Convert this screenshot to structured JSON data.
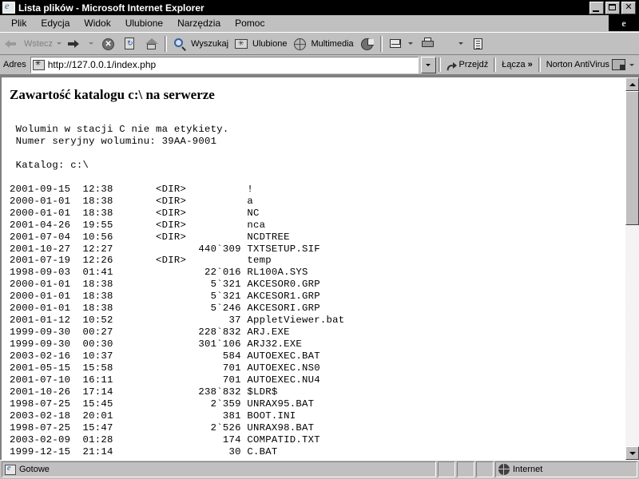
{
  "window": {
    "title": "Lista plików - Microsoft Internet Explorer",
    "app_icon": "ie-document-icon",
    "controls": {
      "minimize": "_",
      "maximize": "□",
      "close": "✕"
    }
  },
  "menubar": {
    "items": [
      {
        "label": "Plik",
        "name": "menu-file"
      },
      {
        "label": "Edycja",
        "name": "menu-edit"
      },
      {
        "label": "Widok",
        "name": "menu-view"
      },
      {
        "label": "Ulubione",
        "name": "menu-favorites"
      },
      {
        "label": "Narzędzia",
        "name": "menu-tools"
      },
      {
        "label": "Pomoc",
        "name": "menu-help"
      }
    ],
    "brand_glyph": "e"
  },
  "toolbar": {
    "back_label": "Wstecz",
    "forward_label": "",
    "search_label": "Wyszukaj",
    "favorites_label": "Ulubione",
    "multimedia_label": "Multimedia"
  },
  "addressbar": {
    "label": "Adres",
    "url": "http://127.0.0.1/index.php",
    "placeholder": "http://",
    "go_label": "Przejdź",
    "links_label": "Łącza",
    "links_chevron": "»",
    "antivirus_label": "Norton AntiVirus"
  },
  "page": {
    "heading": "Zawartość katalogu c:\\ na serwerze",
    "volume_info_line1": " Wolumin w stacji C nie ma etykiety.",
    "volume_info_line2": " Numer seryjny woluminu: 39AA-9001",
    "directory_line": " Katalog: c:\\",
    "listing_text": " Wolumin w stacji C nie ma etykiety.\n Numer seryjny woluminu: 39AA-9001\n\n Katalog: c:\\\n\n2001-09-15  12:38       <DIR>          !\n2000-01-01  18:38       <DIR>          a\n2000-01-01  18:38       <DIR>          NC\n2001-04-26  19:55       <DIR>          nca\n2001-07-04  10:56       <DIR>          NCDTREE\n2001-10-27  12:27              440`309 TXTSETUP.SIF\n2001-07-19  12:26       <DIR>          temp\n1998-09-03  01:41               22`016 RL100A.SYS\n2000-01-01  18:38                5`321 AKCESOR0.GRP\n2000-01-01  18:38                5`321 AKCESOR1.GRP\n2000-01-01  18:38                5`246 AKCESORI.GRP\n2001-01-12  10:52                   37 AppletViewer.bat\n1999-09-30  00:27              228`832 ARJ.EXE\n1999-09-30  00:30              301`106 ARJ32.EXE\n2003-02-16  10:37                  584 AUTOEXEC.BAT\n2001-05-15  15:58                  701 AUTOEXEC.NS0\n2001-07-10  16:11                  701 AUTOEXEC.NU4\n2001-10-26  17:14              238`832 $LDR$\n1998-07-25  15:45                2`359 UNRAX95.BAT\n2003-02-18  20:01                  381 BOOT.INI\n1998-07-25  15:47                2`526 UNRAX98.BAT\n2003-02-09  01:28                  174 COMPATID.TXT\n1999-12-15  21:14                   30 C.BAT",
    "entries": [
      {
        "date": "2001-09-15",
        "time": "12:38",
        "type": "<DIR>",
        "size": "",
        "name": "!"
      },
      {
        "date": "2000-01-01",
        "time": "18:38",
        "type": "<DIR>",
        "size": "",
        "name": "a"
      },
      {
        "date": "2000-01-01",
        "time": "18:38",
        "type": "<DIR>",
        "size": "",
        "name": "NC"
      },
      {
        "date": "2001-04-26",
        "time": "19:55",
        "type": "<DIR>",
        "size": "",
        "name": "nca"
      },
      {
        "date": "2001-07-04",
        "time": "10:56",
        "type": "<DIR>",
        "size": "",
        "name": "NCDTREE"
      },
      {
        "date": "2001-10-27",
        "time": "12:27",
        "type": "",
        "size": "440`309",
        "name": "TXTSETUP.SIF"
      },
      {
        "date": "2001-07-19",
        "time": "12:26",
        "type": "<DIR>",
        "size": "",
        "name": "temp"
      },
      {
        "date": "1998-09-03",
        "time": "01:41",
        "type": "",
        "size": "22`016",
        "name": "RL100A.SYS"
      },
      {
        "date": "2000-01-01",
        "time": "18:38",
        "type": "",
        "size": "5`321",
        "name": "AKCESOR0.GRP"
      },
      {
        "date": "2000-01-01",
        "time": "18:38",
        "type": "",
        "size": "5`321",
        "name": "AKCESOR1.GRP"
      },
      {
        "date": "2000-01-01",
        "time": "18:38",
        "type": "",
        "size": "5`246",
        "name": "AKCESORI.GRP"
      },
      {
        "date": "2001-01-12",
        "time": "10:52",
        "type": "",
        "size": "37",
        "name": "AppletViewer.bat"
      },
      {
        "date": "1999-09-30",
        "time": "00:27",
        "type": "",
        "size": "228`832",
        "name": "ARJ.EXE"
      },
      {
        "date": "1999-09-30",
        "time": "00:30",
        "type": "",
        "size": "301`106",
        "name": "ARJ32.EXE"
      },
      {
        "date": "2003-02-16",
        "time": "10:37",
        "type": "",
        "size": "584",
        "name": "AUTOEXEC.BAT"
      },
      {
        "date": "2001-05-15",
        "time": "15:58",
        "type": "",
        "size": "701",
        "name": "AUTOEXEC.NS0"
      },
      {
        "date": "2001-07-10",
        "time": "16:11",
        "type": "",
        "size": "701",
        "name": "AUTOEXEC.NU4"
      },
      {
        "date": "2001-10-26",
        "time": "17:14",
        "type": "",
        "size": "238`832",
        "name": "$LDR$"
      },
      {
        "date": "1998-07-25",
        "time": "15:45",
        "type": "",
        "size": "2`359",
        "name": "UNRAX95.BAT"
      },
      {
        "date": "2003-02-18",
        "time": "20:01",
        "type": "",
        "size": "381",
        "name": "BOOT.INI"
      },
      {
        "date": "1998-07-25",
        "time": "15:47",
        "type": "",
        "size": "2`526",
        "name": "UNRAX98.BAT"
      },
      {
        "date": "2003-02-09",
        "time": "01:28",
        "type": "",
        "size": "174",
        "name": "COMPATID.TXT"
      },
      {
        "date": "1999-12-15",
        "time": "21:14",
        "type": "",
        "size": "30",
        "name": "C.BAT"
      }
    ]
  },
  "statusbar": {
    "status_text": "Gotowe",
    "zone_text": "Internet"
  },
  "colors": {
    "face": "#c0c0c0",
    "titlebar_bg": "#000000",
    "titlebar_fg": "#ffffff",
    "page_bg": "#ffffff",
    "text": "#000000"
  }
}
